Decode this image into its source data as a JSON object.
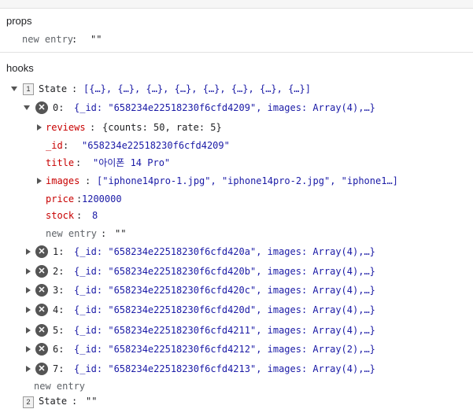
{
  "props": {
    "title": "props",
    "new_entry_label": "new entry",
    "new_entry_value": "\"\""
  },
  "hooks": {
    "title": "hooks",
    "state1": {
      "index": "1",
      "label": "State",
      "summary": "[{…}, {…}, {…}, {…}, {…}, {…}, {…}, {…}]"
    },
    "item0": {
      "index_label": "0:",
      "summary": "{_id: \"658234e22518230f6cfd4209\", images: Array(4),…}",
      "fields": {
        "reviews_key": "reviews",
        "reviews_value": "{counts: 50, rate: 5}",
        "id_key": "_id",
        "id_value": "\"658234e22518230f6cfd4209\"",
        "title_key": "title",
        "title_value": "\"아이폰 14 Pro\"",
        "images_key": "images",
        "images_value": "[\"iphone14pro-1.jpg\", \"iphone14pro-2.jpg\", \"iphone1…]",
        "price_key": "price",
        "price_value": "1200000",
        "stock_key": "stock",
        "stock_value": "8",
        "new_entry_label": "new entry",
        "new_entry_value": "\"\""
      }
    },
    "items": [
      {
        "index_label": "1:",
        "summary": "{_id: \"658234e22518230f6cfd420a\", images: Array(4),…}"
      },
      {
        "index_label": "2:",
        "summary": "{_id: \"658234e22518230f6cfd420b\", images: Array(4),…}"
      },
      {
        "index_label": "3:",
        "summary": "{_id: \"658234e22518230f6cfd420c\", images: Array(4),…}"
      },
      {
        "index_label": "4:",
        "summary": "{_id: \"658234e22518230f6cfd420d\", images: Array(4),…}"
      },
      {
        "index_label": "5:",
        "summary": "{_id: \"658234e22518230f6cfd4211\", images: Array(4),…}"
      },
      {
        "index_label": "6:",
        "summary": "{_id: \"658234e22518230f6cfd4212\", images: Array(2),…}"
      },
      {
        "index_label": "7:",
        "summary": "{_id: \"658234e22518230f6cfd4213\", images: Array(4),…}"
      }
    ],
    "list_new_entry_label": "new entry",
    "state2": {
      "index": "2",
      "label": "State",
      "value": "\"\""
    }
  },
  "icons": {
    "expanded": "triangle-down-icon",
    "collapsed": "triangle-right-icon",
    "delete": "close-circle-icon"
  }
}
